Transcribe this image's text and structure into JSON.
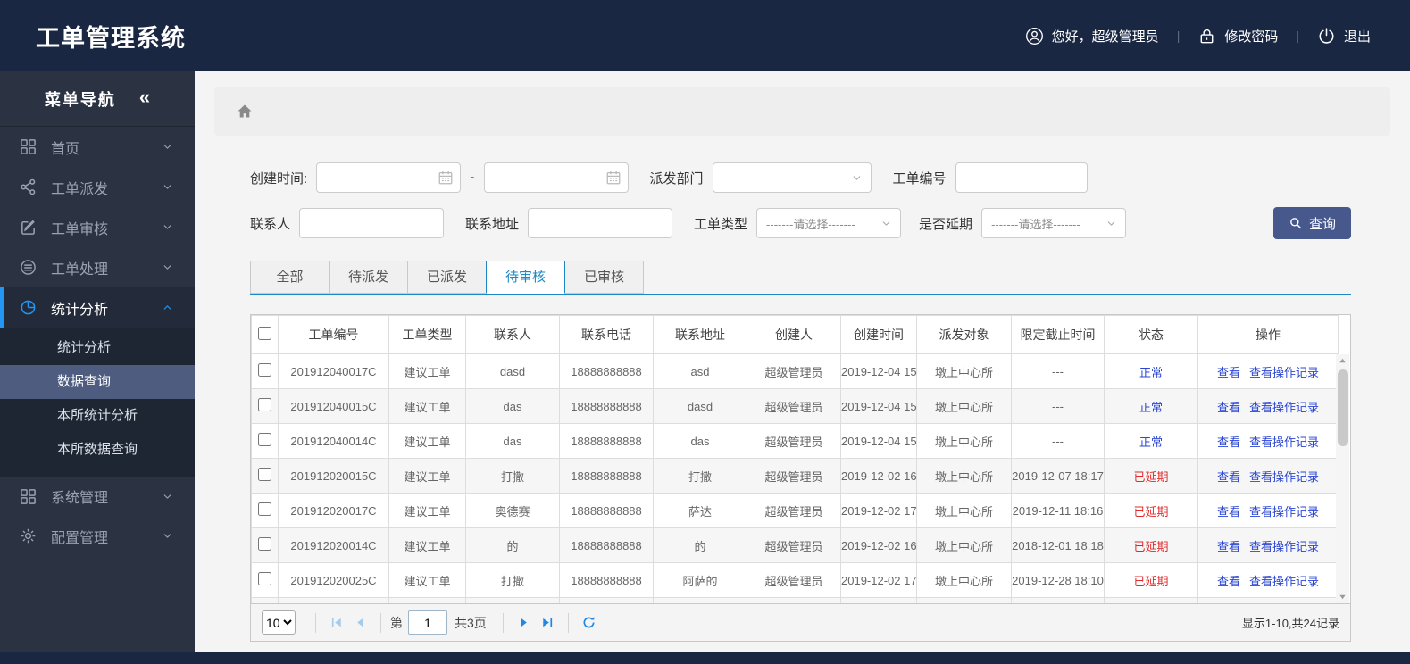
{
  "colors": {
    "navy": "#1a2742",
    "sidebar": "#2b3342",
    "accent": "#2196f3",
    "tab_line": "#1e88c5",
    "link": "#2b46d3",
    "danger": "#e02b2b",
    "search_button": "#47598c"
  },
  "header": {
    "title": "工单管理系统",
    "greeting": "您好，超级管理员",
    "change_password": "修改密码",
    "logout": "退出"
  },
  "sidebar": {
    "title": "菜单导航",
    "collapse_glyph": "«",
    "items": [
      {
        "label": "首页",
        "icon": "grid",
        "expanded": false,
        "active": false
      },
      {
        "label": "工单派发",
        "icon": "share",
        "expanded": false,
        "active": false
      },
      {
        "label": "工单审核",
        "icon": "edit",
        "expanded": false,
        "active": false
      },
      {
        "label": "工单处理",
        "icon": "stack",
        "expanded": false,
        "active": false
      },
      {
        "label": "统计分析",
        "icon": "pie-chart",
        "expanded": true,
        "active": true,
        "children": [
          {
            "label": "统计分析",
            "active": false
          },
          {
            "label": "数据查询",
            "active": true
          },
          {
            "label": "本所统计分析",
            "active": false
          },
          {
            "label": "本所数据查询",
            "active": false
          }
        ]
      },
      {
        "label": "系统管理",
        "icon": "grid",
        "expanded": false,
        "active": false,
        "separated": true
      },
      {
        "label": "配置管理",
        "icon": "gear",
        "expanded": false,
        "active": false
      }
    ]
  },
  "search_form": {
    "created_time_label": "创建时间:",
    "date_start_value": "",
    "date_separator": "-",
    "date_end_value": "",
    "dispatch_dept_label": "派发部门",
    "dispatch_dept_value": "",
    "order_no_label": "工单编号",
    "order_no_value": "",
    "contact_label": "联系人",
    "contact_value": "",
    "contact_address_label": "联系地址",
    "contact_address_value": "",
    "order_type_label": "工单类型",
    "order_type_placeholder": "-------请选择-------",
    "is_delayed_label": "是否延期",
    "is_delayed_placeholder": "-------请选择-------",
    "search_button": "查询"
  },
  "tabs": [
    {
      "label": "全部",
      "active": false
    },
    {
      "label": "待派发",
      "active": false
    },
    {
      "label": "已派发",
      "active": false
    },
    {
      "label": "待审核",
      "active": true
    },
    {
      "label": "已审核",
      "active": false
    }
  ],
  "table": {
    "columns": [
      "工单编号",
      "工单类型",
      "联系人",
      "联系电话",
      "联系地址",
      "创建人",
      "创建时间",
      "派发对象",
      "限定截止时间",
      "状态",
      "操作"
    ],
    "view_label": "查看",
    "view_log_label": "查看操作记录",
    "status_normal": "正常",
    "status_delayed": "已延期",
    "rows": [
      {
        "order_no": "201912040017C",
        "type": "建议工单",
        "contact": "dasd",
        "phone": "18888888888",
        "address": "asd",
        "creator": "超级管理员",
        "created": "2019-12-04 15",
        "target": "墩上中心所",
        "deadline": "---",
        "status": "正常",
        "delayed": false
      },
      {
        "order_no": "201912040015C",
        "type": "建议工单",
        "contact": "das",
        "phone": "18888888888",
        "address": "dasd",
        "creator": "超级管理员",
        "created": "2019-12-04 15",
        "target": "墩上中心所",
        "deadline": "---",
        "status": "正常",
        "delayed": false
      },
      {
        "order_no": "201912040014C",
        "type": "建议工单",
        "contact": "das",
        "phone": "18888888888",
        "address": "das",
        "creator": "超级管理员",
        "created": "2019-12-04 15",
        "target": "墩上中心所",
        "deadline": "---",
        "status": "正常",
        "delayed": false
      },
      {
        "order_no": "201912020015C",
        "type": "建议工单",
        "contact": "打撒",
        "phone": "18888888888",
        "address": "打撒",
        "creator": "超级管理员",
        "created": "2019-12-02 16",
        "target": "墩上中心所",
        "deadline": "2019-12-07 18:17",
        "status": "已延期",
        "delayed": true
      },
      {
        "order_no": "201912020017C",
        "type": "建议工单",
        "contact": "奥德赛",
        "phone": "18888888888",
        "address": "萨达",
        "creator": "超级管理员",
        "created": "2019-12-02 17",
        "target": "墩上中心所",
        "deadline": "2019-12-11 18:16",
        "status": "已延期",
        "delayed": true
      },
      {
        "order_no": "201912020014C",
        "type": "建议工单",
        "contact": "的",
        "phone": "18888888888",
        "address": "的",
        "creator": "超级管理员",
        "created": "2019-12-02 16",
        "target": "墩上中心所",
        "deadline": "2018-12-01 18:18",
        "status": "已延期",
        "delayed": true
      },
      {
        "order_no": "201912020025C",
        "type": "建议工单",
        "contact": "打撒",
        "phone": "18888888888",
        "address": "阿萨的",
        "creator": "超级管理员",
        "created": "2019-12-02 17",
        "target": "墩上中心所",
        "deadline": "2019-12-28 18:10",
        "status": "已延期",
        "delayed": true
      }
    ]
  },
  "pagination": {
    "page_size": "10",
    "page_prefix": "第",
    "current_page": "1",
    "total_pages": "共3页",
    "record_info": "显示1-10,共24记录"
  }
}
